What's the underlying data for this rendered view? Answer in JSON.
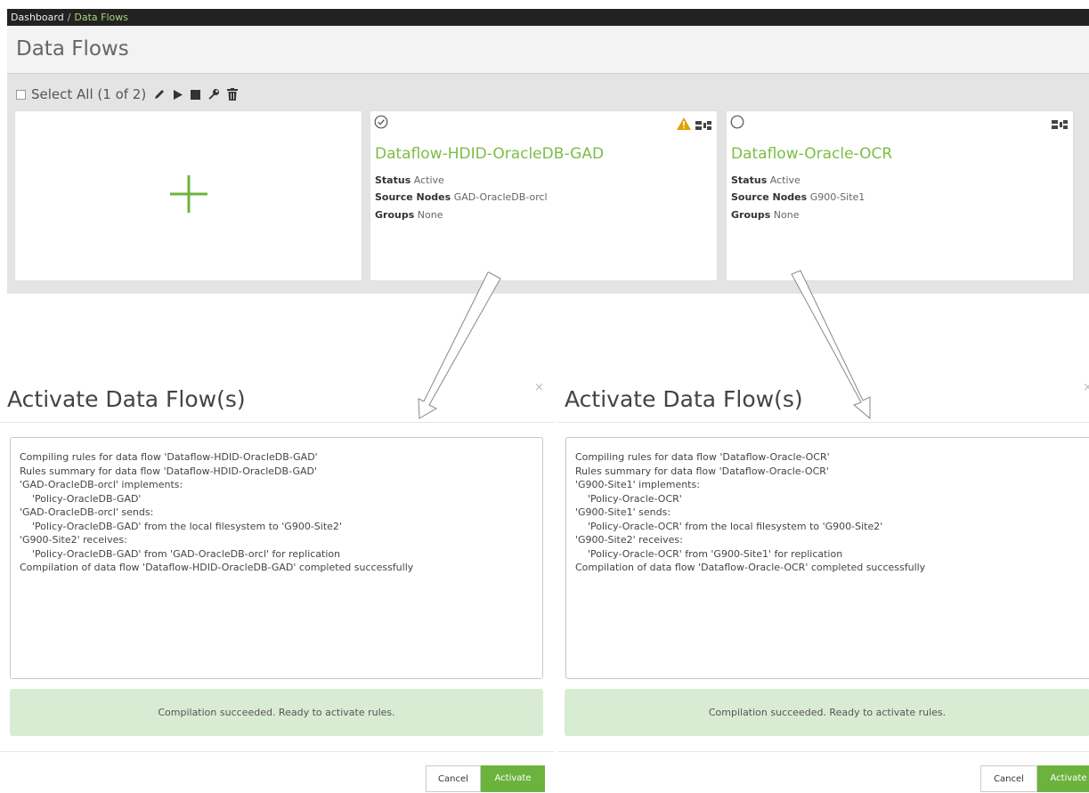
{
  "breadcrumb": {
    "root": "Dashboard",
    "separator": "/",
    "current": "Data Flows"
  },
  "page_title": "Data Flows",
  "toolbar": {
    "select_all_label": "Select All (1 of 2)",
    "icons": [
      "edit-icon",
      "play-icon",
      "stop-icon",
      "wrench-icon",
      "trash-icon"
    ]
  },
  "add_card": {
    "icon": "plus-icon",
    "color": "#6cb33e"
  },
  "flows": [
    {
      "selected": true,
      "warning": true,
      "name": "Dataflow-HDID-OracleDB-GAD",
      "status_label": "Status",
      "status": "Active",
      "source_label": "Source Nodes",
      "source": "GAD-OracleDB-orcl",
      "groups_label": "Groups",
      "groups": "None"
    },
    {
      "selected": false,
      "warning": false,
      "name": "Dataflow-Oracle-OCR",
      "status_label": "Status",
      "status": "Active",
      "source_label": "Source Nodes",
      "source": "G900-Site1",
      "groups_label": "Groups",
      "groups": "None"
    }
  ],
  "dialogs": [
    {
      "title": "Activate Data Flow(s)",
      "close": "×",
      "log": "Compiling rules for data flow 'Dataflow-HDID-OracleDB-GAD'\nRules summary for data flow 'Dataflow-HDID-OracleDB-GAD'\n'GAD-OracleDB-orcl' implements:\n    'Policy-OracleDB-GAD'\n'GAD-OracleDB-orcl' sends:\n    'Policy-OracleDB-GAD' from the local filesystem to 'G900-Site2'\n'G900-Site2' receives:\n    'Policy-OracleDB-GAD' from 'GAD-OracleDB-orcl' for replication\nCompilation of data flow 'Dataflow-HDID-OracleDB-GAD' completed successfully",
      "alert": "Compilation succeeded. Ready to activate rules.",
      "cancel": "Cancel",
      "activate": "Activate"
    },
    {
      "title": "Activate Data Flow(s)",
      "close": "×",
      "log": "Compiling rules for data flow 'Dataflow-Oracle-OCR'\nRules summary for data flow 'Dataflow-Oracle-OCR'\n'G900-Site1' implements:\n    'Policy-Oracle-OCR'\n'G900-Site1' sends:\n    'Policy-Oracle-OCR' from the local filesystem to 'G900-Site2'\n'G900-Site2' receives:\n    'Policy-Oracle-OCR' from 'G900-Site1' for replication\nCompilation of data flow 'Dataflow-Oracle-OCR' completed successfully",
      "alert": "Compilation succeeded. Ready to activate rules.",
      "cancel": "Cancel",
      "activate": "Activate"
    }
  ],
  "colors": {
    "accent_green": "#6cb33e",
    "flow_name_green": "#7cbd46",
    "crumb_current": "#a5d67a",
    "alert_bg": "#d8ecd4",
    "warning": "#e0a100"
  }
}
